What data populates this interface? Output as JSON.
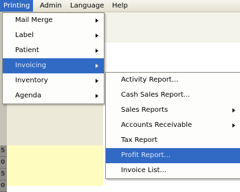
{
  "menubar": {
    "items": [
      {
        "label": "Printing"
      },
      {
        "label": "Admin"
      },
      {
        "label": "Language"
      },
      {
        "label": "Help"
      }
    ]
  },
  "left_column": [
    "5",
    "0",
    "5",
    "0"
  ],
  "printing_menu": {
    "items": [
      {
        "label": "Mail Merge"
      },
      {
        "label": "Label"
      },
      {
        "label": "Patient"
      },
      {
        "label": "Invoicing"
      },
      {
        "label": "Inventory"
      },
      {
        "label": "Agenda"
      }
    ],
    "highlighted": "Invoicing"
  },
  "invoicing_menu": {
    "items": [
      {
        "label": "Activity Report..."
      },
      {
        "label": "Cash Sales Report..."
      },
      {
        "label": "Sales Reports"
      },
      {
        "label": "Accounts Receivable"
      },
      {
        "label": "Tax Report"
      },
      {
        "label": "Profit Report..."
      },
      {
        "label": "Invoice List..."
      }
    ],
    "highlighted": "Profit Report..."
  },
  "colors": {
    "highlight": "#316ac5",
    "menubar_bg": "#ece9d8",
    "yellow_panel": "#fffcc0"
  }
}
